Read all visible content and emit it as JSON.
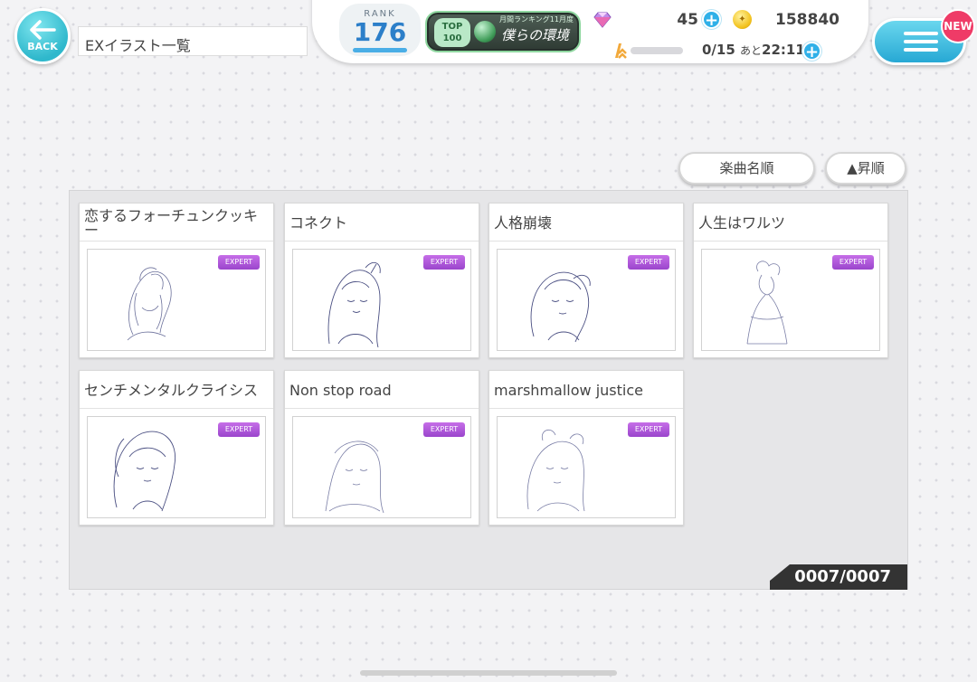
{
  "header": {
    "back_label": "BACK",
    "page_title": "EXイラスト一覧"
  },
  "status": {
    "rank_label": "RANK",
    "rank_value": "176",
    "ranking_top_line1": "TOP",
    "ranking_top_line2": "100",
    "ranking_small": "月間ランキング11月度",
    "ranking_name": "僕らの環境",
    "gem_count": "45",
    "coin_count": "158840",
    "live_status": "0/15",
    "live_recover_prefix": "あと",
    "live_recover_time": "22:11"
  },
  "menu": {
    "new_badge": "NEW"
  },
  "sort": {
    "sort_by": "楽曲名順",
    "order": "▲昇順"
  },
  "cards": [
    {
      "title": "恋するフォーチュンクッキー",
      "difficulty": "EXPERT"
    },
    {
      "title": "コネクト",
      "difficulty": "EXPERT"
    },
    {
      "title": "人格崩壊",
      "difficulty": "EXPERT"
    },
    {
      "title": "人生はワルツ",
      "difficulty": "EXPERT"
    },
    {
      "title": "センチメンタルクライシス",
      "difficulty": "EXPERT"
    },
    {
      "title": "Non stop road",
      "difficulty": "EXPERT"
    },
    {
      "title": "marshmallow justice",
      "difficulty": "EXPERT"
    }
  ],
  "counter": "0007/0007",
  "colors": {
    "accent": "#2fb8cc",
    "expert": "#b058dc",
    "new_badge": "#ef3b67"
  }
}
